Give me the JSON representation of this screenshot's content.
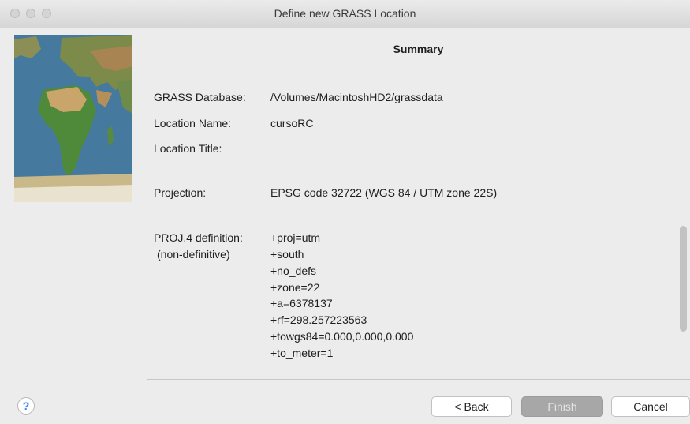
{
  "window": {
    "title": "Define new GRASS Location"
  },
  "header": {
    "title": "Summary"
  },
  "summary": {
    "database_label": "GRASS Database:",
    "database_value": "/Volumes/MacintoshHD2/grassdata",
    "location_name_label": "Location Name:",
    "location_name_value": "cursoRC",
    "location_title_label": "Location Title:",
    "location_title_value": "",
    "projection_label": "Projection:",
    "projection_value": "EPSG code 32722 (WGS 84 / UTM zone 22S)",
    "proj4_label": "PROJ.4 definition:",
    "proj4_sublabel": "(non-definitive)",
    "proj4_lines": [
      "+proj=utm",
      "+south",
      "+no_defs",
      "+zone=22",
      "+a=6378137",
      "+rf=298.257223563",
      "+towgs84=0.000,0.000,0.000",
      "+to_meter=1"
    ]
  },
  "buttons": {
    "help": "?",
    "back": "< Back",
    "finish": "Finish",
    "cancel": "Cancel"
  },
  "icons": {
    "help": "help-icon",
    "map": "world-map-image"
  }
}
